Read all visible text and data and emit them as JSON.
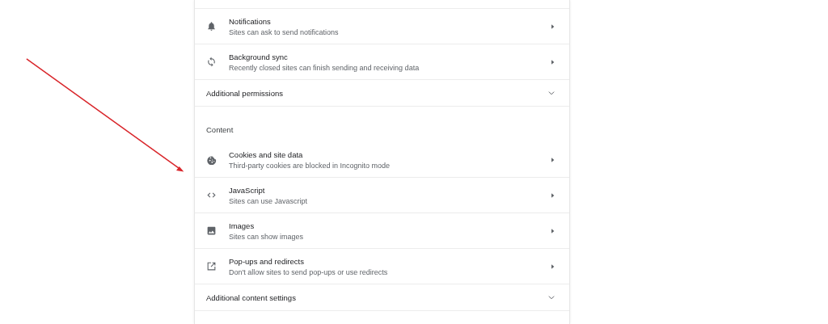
{
  "rows": [
    {
      "kind": "link",
      "title": "Notifications",
      "subtitle": "Sites can ask to send notifications"
    },
    {
      "kind": "link",
      "title": "Background sync",
      "subtitle": "Recently closed sites can finish sending and receiving data"
    },
    {
      "kind": "expand",
      "title": "Additional permissions"
    },
    {
      "kind": "header",
      "title": "Content"
    },
    {
      "kind": "link",
      "title": "Cookies and site data",
      "subtitle": "Third-party cookies are blocked in Incognito mode"
    },
    {
      "kind": "link",
      "title": "JavaScript",
      "subtitle": "Sites can use Javascript"
    },
    {
      "kind": "link",
      "title": "Images",
      "subtitle": "Sites can show images"
    },
    {
      "kind": "link",
      "title": "Pop-ups and redirects",
      "subtitle": "Don't allow sites to send pop-ups or use redirects"
    },
    {
      "kind": "expand",
      "title": "Additional content settings"
    }
  ]
}
